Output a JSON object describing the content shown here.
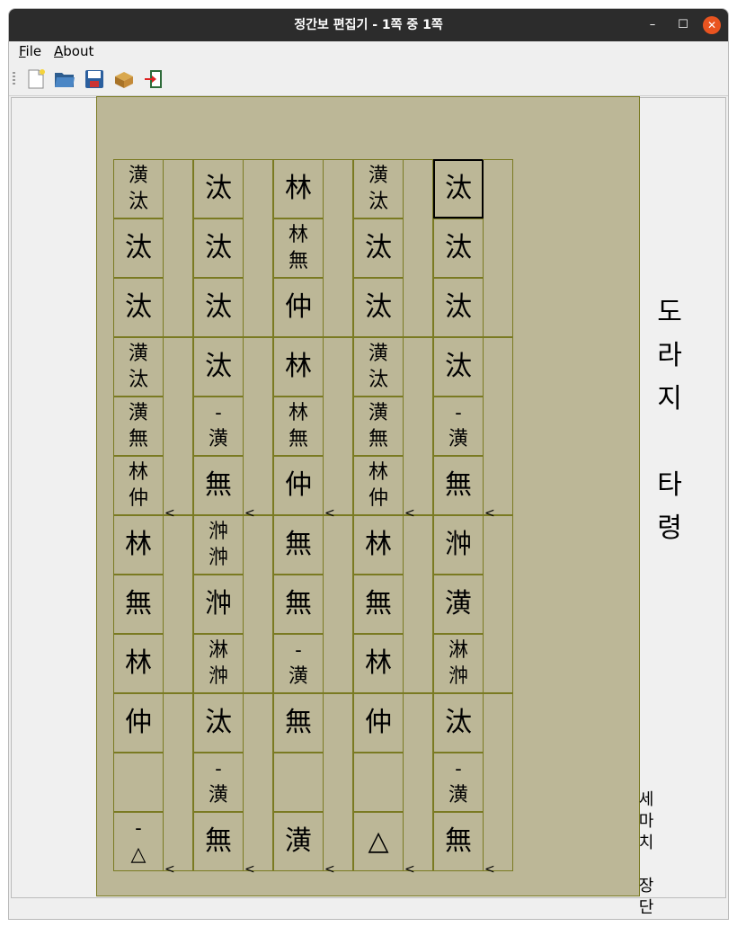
{
  "window": {
    "title": "정간보 편집기 - 1쪽 중 1쪽",
    "min_label": "–",
    "max_label": "☐",
    "close_label": "✕"
  },
  "menu": [
    {
      "prefix": "F",
      "rest": "ile"
    },
    {
      "prefix": "A",
      "rest": "bout"
    }
  ],
  "toolbar": [
    "new-file",
    "open-folder",
    "save",
    "package",
    "exit"
  ],
  "score": {
    "title": [
      "도",
      "라",
      "지",
      "",
      "타",
      "령"
    ],
    "style": [
      "세",
      "마",
      "치",
      "",
      "장",
      "단"
    ],
    "columns": [
      [
        [
          "潢",
          "汰"
        ],
        [
          "汰"
        ],
        [
          "汰"
        ],
        [
          "潢",
          "汰"
        ],
        [
          "潢",
          "無"
        ],
        [
          "林",
          "仲"
        ],
        [
          "林"
        ],
        [
          "無"
        ],
        [
          "林"
        ],
        [
          "仲"
        ],
        [
          ""
        ],
        [
          "-",
          "△"
        ]
      ],
      [
        [
          "汰"
        ],
        [
          "汰"
        ],
        [
          "汰"
        ],
        [
          "汰"
        ],
        [
          "-",
          "潢"
        ],
        [
          "無"
        ],
        [
          "浺",
          "浺"
        ],
        [
          "浺"
        ],
        [
          "淋",
          "浺"
        ],
        [
          "汰"
        ],
        [
          "-",
          "潢"
        ],
        [
          "無"
        ]
      ],
      [
        [
          "林"
        ],
        [
          "林",
          "無"
        ],
        [
          "仲"
        ],
        [
          "林"
        ],
        [
          "林",
          "無"
        ],
        [
          "仲"
        ],
        [
          "無"
        ],
        [
          "無"
        ],
        [
          "-",
          "潢"
        ],
        [
          "無"
        ],
        [
          ""
        ],
        [
          "潢"
        ]
      ],
      [
        [
          "潢",
          "汰"
        ],
        [
          "汰"
        ],
        [
          "汰"
        ],
        [
          "潢",
          "汰"
        ],
        [
          "潢",
          "無"
        ],
        [
          "林",
          "仲"
        ],
        [
          "林"
        ],
        [
          "無"
        ],
        [
          "林"
        ],
        [
          "仲"
        ],
        [
          ""
        ],
        [
          "△"
        ]
      ],
      [
        [
          "汰"
        ],
        [
          "汰"
        ],
        [
          "汰"
        ],
        [
          "汰"
        ],
        [
          "-",
          "潢"
        ],
        [
          "無"
        ],
        [
          "浺"
        ],
        [
          "潢"
        ],
        [
          "淋",
          "浺"
        ],
        [
          "汰"
        ],
        [
          "-",
          "潢"
        ],
        [
          "無"
        ]
      ]
    ],
    "arrow_glyph": "<",
    "selected": {
      "column": 4,
      "row": 0
    }
  }
}
